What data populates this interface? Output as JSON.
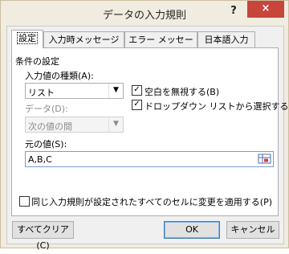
{
  "window": {
    "title": "データの入力規則",
    "help": "?",
    "close": "×"
  },
  "tabs": [
    {
      "label": "設定",
      "active": true
    },
    {
      "label": "入力時メッセージ",
      "active": false
    },
    {
      "label": "エラー メッセージ",
      "active": false
    },
    {
      "label": "日本語入力",
      "active": false
    }
  ],
  "settings": {
    "section_title": "条件の設定",
    "allow_label": "入力値の種類(A):",
    "allow_value": "リスト",
    "data_label": "データ(D):",
    "data_value": "次の値の間",
    "ignore_blank": {
      "label": "空白を無視する(B)",
      "checked": true
    },
    "in_cell_dropdown": {
      "label": "ドロップダウン リストから選択する(I)",
      "checked": true
    },
    "source_label": "元の値(S):",
    "source_value": "A,B,C",
    "apply_all": {
      "label": "同じ入力規則が設定されたすべてのセルに変更を適用する(P)",
      "checked": false
    }
  },
  "buttons": {
    "clear_all": "すべてクリア(C)",
    "ok": "OK",
    "cancel": "キャンセル"
  }
}
